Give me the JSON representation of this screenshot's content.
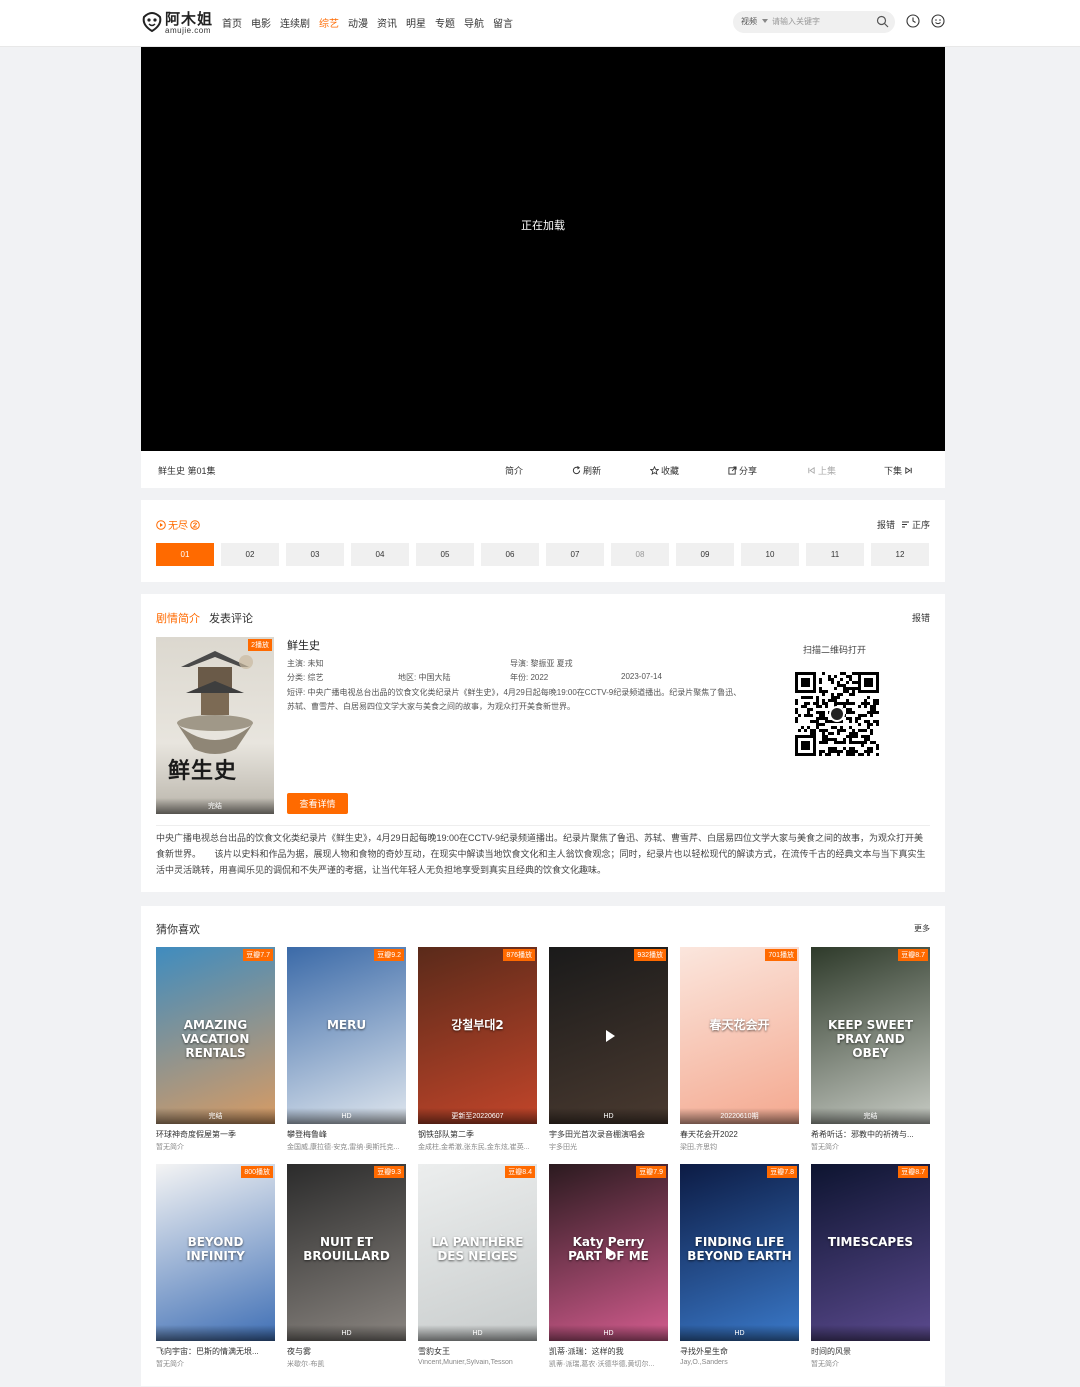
{
  "site": {
    "name": "阿木姐",
    "domain": "amujie.com"
  },
  "nav": [
    "首页",
    "电影",
    "连续剧",
    "综艺",
    "动漫",
    "资讯",
    "明星",
    "专题",
    "导航",
    "留言"
  ],
  "nav_active_index": 3,
  "search": {
    "category": "视频",
    "placeholder": "请输入关键字"
  },
  "player": {
    "loading_text": "正在加载"
  },
  "player_bar": {
    "title": "鲜生史  第01集",
    "intro": "简介",
    "refresh": "刷新",
    "favorite": "收藏",
    "share": "分享",
    "prev": "上集",
    "next": "下集"
  },
  "episodes": {
    "source": "无尽",
    "report": "报错",
    "order": "正序",
    "items": [
      "01",
      "02",
      "03",
      "04",
      "05",
      "06",
      "07",
      "08",
      "09",
      "10",
      "11",
      "12"
    ]
  },
  "info": {
    "tab_plot": "剧情简介",
    "tab_comment": "发表评论",
    "report": "报错",
    "badge": "2播放",
    "status": "完结",
    "poster_text": "鲜生史",
    "title": "鲜生史",
    "starring": "主演: 未知",
    "director": "导演: 黎振亚 夏戎",
    "genre": "分类: 综艺",
    "region": "地区: 中国大陆",
    "year": "年份: 2022",
    "date": "2023-07-14",
    "short": "短评: 中央广播电视总台出品的饮食文化类纪录片《鲜生史》，4月29日起每晚19:00在CCTV-9纪录频道播出。纪录片聚焦了鲁迅、苏轼、曹雪芹、白居易四位文学大家与美食之间的故事，为观众打开美食新世界。",
    "detail_button": "查看详情",
    "qr_title": "扫描二维码打开",
    "description": "中央广播电视总台出品的饮食文化类纪录片《鲜生史》，4月29日起每晚19:00在CCTV-9纪录频道播出。纪录片聚焦了鲁迅、苏轼、曹雪芹、白居易四位文学大家与美食之间的故事，为观众打开美食新世界。　　该片以史料和作品为据，展现人物和食物的奇妙互动，在现实中解读当地饮食文化和主人翁饮食观念；同时，纪录片也以轻松现代的解读方式，在流传千古的经典文本与当下真实生活中灵活跳转，用喜闻乐见的调侃和不失严谨的考据，让当代年轻人无负担地享受到真实且经典的饮食文化趣味。"
  },
  "recommend": {
    "heading": "猜你喜欢",
    "more": "更多",
    "items": [
      {
        "title": "环球神奇度假屋第一季",
        "sub": "暂无简介",
        "badge": "豆瓣7.7",
        "status": "完结",
        "poster_text": "AMAZING VACATION RENTALS",
        "bg": "#3f8cbf",
        "bg2": "#d89b63"
      },
      {
        "title": "攀登梅鲁峰",
        "sub": "金国威,康拉德·安克,雷纳·奥斯托克...",
        "badge": "豆瓣9.2",
        "status": "HD",
        "poster_text": "MERU",
        "bg": "#3b6aa8",
        "bg2": "#dfe6ee"
      },
      {
        "title": "钢铁部队第二季",
        "sub": "金成柱,金希澈,张东民,金东炫,崔英...",
        "badge": "876播放",
        "status": "更新至20220607",
        "poster_text": "강철부대2",
        "bg": "#5a2a1a",
        "bg2": "#c2452a"
      },
      {
        "title": "宇多田光首次录音棚演唱会",
        "sub": "宇多田光",
        "badge": "932播放",
        "status": "HD",
        "poster_text": "",
        "bg": "#1a1a1a",
        "bg2": "#4a3a30"
      },
      {
        "title": "春天花会开2022",
        "sub": "梁田,齐思钧",
        "badge": "701播放",
        "status": "20220610期",
        "poster_text": "春天花会开",
        "bg": "#fbe6dd",
        "bg2": "#f4a88f"
      },
      {
        "title": "希希听话：邪教中的祈祷与...",
        "sub": "暂无简介",
        "badge": "豆瓣8.7",
        "status": "完结",
        "poster_text": "KEEP SWEET PRAY AND OBEY",
        "bg": "#2e3a2a",
        "bg2": "#c7cbc4"
      },
      {
        "title": "飞向宇宙：巴斯的情满无垠...",
        "sub": "暂无简介",
        "badge": "800播放",
        "status": "",
        "poster_text": "BEYOND INFINITY",
        "bg": "#f4f4f4",
        "bg2": "#3f6fb5"
      },
      {
        "title": "夜与雾",
        "sub": "米歇尔·布凯",
        "badge": "豆瓣9.3",
        "status": "HD",
        "poster_text": "NUIT ET BROUILLARD",
        "bg": "#2b2b2b",
        "bg2": "#8a8580"
      },
      {
        "title": "雪豹女王",
        "sub": "Vincent,Munier,Sylvain,Tesson",
        "badge": "豆瓣8.4",
        "status": "HD",
        "poster_text": "LA PANTHÈRE DES NEIGES",
        "bg": "#eceeee",
        "bg2": "#c8cccc"
      },
      {
        "title": "凯蒂·派瑞：这样的我",
        "sub": "凯蒂·派瑞,葛农·沃德华德,黄切尔...",
        "badge": "豆瓣7.9",
        "status": "HD",
        "poster_text": "Katy Perry PART OF ME",
        "bg": "#2b1a1f",
        "bg2": "#d35c8e"
      },
      {
        "title": "寻找外星生命",
        "sub": "Jay,O.,Sanders",
        "badge": "豆瓣7.8",
        "status": "HD",
        "poster_text": "FINDING LIFE BEYOND EARTH",
        "bg": "#0c1b44",
        "bg2": "#3a79c9"
      },
      {
        "title": "时间的风景",
        "sub": "暂无简介",
        "badge": "豆瓣8.7",
        "status": "",
        "poster_text": "TIMESCAPES",
        "bg": "#0d1430",
        "bg2": "#5b4a8e"
      }
    ]
  },
  "colors": {
    "accent": "#ff6a00",
    "player_bg": "#000000",
    "page_bg": "#f1f2f4"
  }
}
